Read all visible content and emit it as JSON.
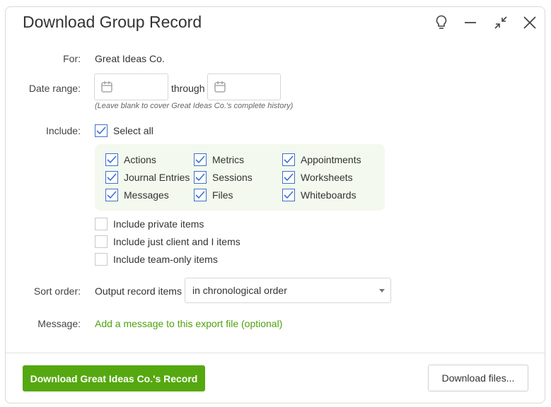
{
  "dialog": {
    "title": "Download Group Record",
    "icons": [
      "lightbulb-icon",
      "minimize-icon",
      "collapse-icon",
      "close-icon"
    ]
  },
  "form": {
    "for_label": "For:",
    "for_value": "Great Ideas Co.",
    "date_label": "Date range:",
    "date_from": "",
    "date_to": "",
    "through": "through",
    "date_hint": "(Leave blank to cover Great Ideas Co.'s complete history)",
    "include_label": "Include:",
    "select_all": {
      "label": "Select all",
      "checked": true
    },
    "items": [
      {
        "label": "Actions",
        "checked": true
      },
      {
        "label": "Metrics",
        "checked": true
      },
      {
        "label": "Appointments",
        "checked": true
      },
      {
        "label": "Journal Entries",
        "checked": true
      },
      {
        "label": "Sessions",
        "checked": true
      },
      {
        "label": "Worksheets",
        "checked": true
      },
      {
        "label": "Messages",
        "checked": true
      },
      {
        "label": "Files",
        "checked": true
      },
      {
        "label": "Whiteboards",
        "checked": true
      }
    ],
    "extras": [
      {
        "label": "Include private items",
        "checked": false
      },
      {
        "label": "Include just client and I items",
        "checked": false
      },
      {
        "label": "Include team-only items",
        "checked": false
      }
    ],
    "sort_label": "Sort order:",
    "sort_prefix": "Output record items",
    "sort_value": "in chronological order",
    "message_label": "Message:",
    "message_link": "Add a message to this export file (optional)"
  },
  "footer": {
    "primary": "Download Great Ideas Co.'s Record",
    "secondary": "Download files..."
  },
  "colors": {
    "accent": "#55a80f",
    "check": "#3f6fcf",
    "group_bg": "#f3f9ee"
  }
}
